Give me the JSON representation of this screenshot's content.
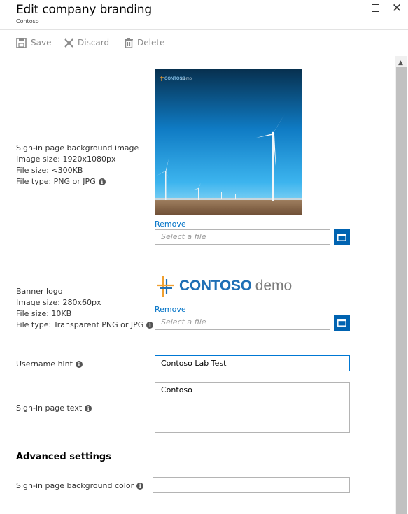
{
  "blade": {
    "title": "Edit company branding",
    "subtitle": "Contoso"
  },
  "toolbar": {
    "save_label": "Save",
    "discard_label": "Discard",
    "delete_label": "Delete"
  },
  "background_image": {
    "label": "Sign-in page background image",
    "size": "Image size: 1920x1080px",
    "file_size": "File size: <300KB",
    "file_type": "File type: PNG or JPG",
    "preview_logo_word": "CONTOSO",
    "preview_logo_demo": "demo",
    "remove_label": "Remove",
    "file_placeholder": "Select a file"
  },
  "banner_logo": {
    "label": "Banner logo",
    "size": "Image size: 280x60px",
    "file_size": "File size: 10KB",
    "file_type": "File type: Transparent PNG or JPG",
    "logo_word": "CONTOSO",
    "logo_demo": "demo",
    "remove_label": "Remove",
    "file_placeholder": "Select a file"
  },
  "username_hint": {
    "label": "Username hint",
    "value": "Contoso Lab Test"
  },
  "signin_text": {
    "label": "Sign-in page text",
    "value": "Contoso"
  },
  "advanced": {
    "heading": "Advanced settings",
    "bg_color_label": "Sign-in page background color",
    "bg_color_value": ""
  },
  "colors": {
    "accent": "#0063b1",
    "link": "#0072c6",
    "sky": "#1a8fd6",
    "ground": "#8a6a4a"
  }
}
